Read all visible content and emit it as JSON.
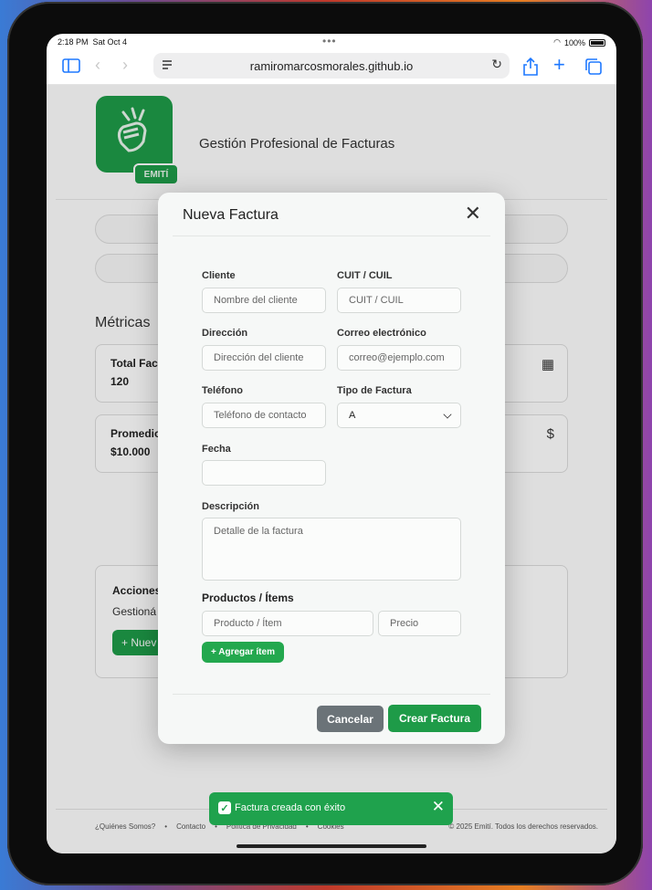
{
  "status": {
    "time": "2:18 PM",
    "date": "Sat Oct 4",
    "battery": "100%"
  },
  "browser": {
    "url": "ramiromarcosmorales.github.io"
  },
  "header": {
    "badge": "EMITÍ",
    "title": "Gestión Profesional de Facturas"
  },
  "metrics": {
    "title": "Métricas",
    "cards": [
      {
        "label": "Total Fac",
        "value": "120",
        "icon": "calculator-icon"
      },
      {
        "label": "Promedio",
        "value": "$10.000",
        "icon": "dollar-icon"
      }
    ]
  },
  "actions": {
    "title": "Acciones",
    "desc": "Gestioná",
    "button": "+ Nuev"
  },
  "modal": {
    "title": "Nueva Factura",
    "fields": {
      "cliente": {
        "label": "Cliente",
        "placeholder": "Nombre del cliente"
      },
      "cuit": {
        "label": "CUIT / CUIL",
        "placeholder": "CUIT / CUIL"
      },
      "direccion": {
        "label": "Dirección",
        "placeholder": "Dirección del cliente"
      },
      "correo": {
        "label": "Correo electrónico",
        "placeholder": "correo@ejemplo.com"
      },
      "telefono": {
        "label": "Teléfono",
        "placeholder": "Teléfono de contacto"
      },
      "tipo": {
        "label": "Tipo de Factura",
        "value": "A"
      },
      "fecha": {
        "label": "Fecha",
        "value": ""
      },
      "descripcion": {
        "label": "Descripción",
        "placeholder": "Detalle de la factura"
      }
    },
    "products": {
      "title": "Productos / Ítems",
      "product_placeholder": "Producto / Ítem",
      "price_placeholder": "Precio",
      "add_label": "+ Agregar ítem"
    },
    "cancel_label": "Cancelar",
    "create_label": "Crear Factura"
  },
  "footer": {
    "links": [
      "¿Quiénes Somos?",
      "•",
      "Contacto",
      "•",
      "Política de Privacidad",
      "•",
      "Cookies"
    ],
    "copyright": "© 2025 Emití. Todos los derechos reservados."
  },
  "toast": {
    "message": "Factura creada con éxito",
    "icon": "check-icon"
  },
  "colors": {
    "brand": "#1e9b48",
    "secondary": "#6b7378"
  }
}
